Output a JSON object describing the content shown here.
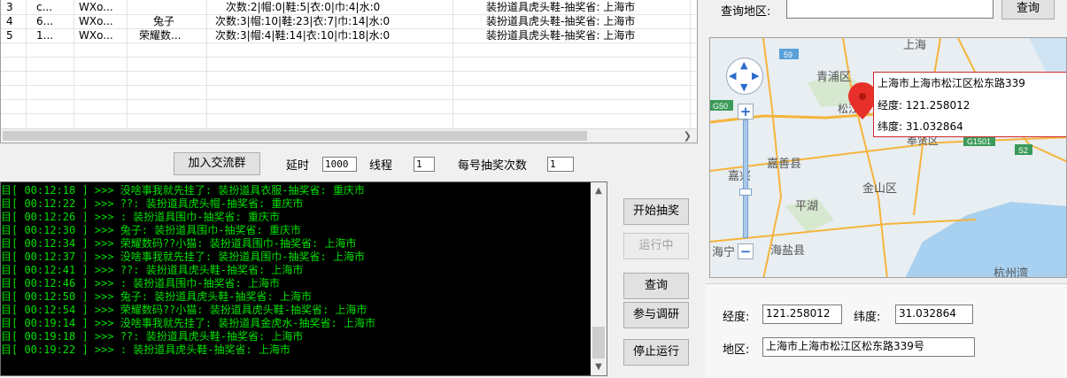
{
  "table": {
    "rows": [
      {
        "id": "3",
        "c1": "c...",
        "c2": "WXo...",
        "c3": "",
        "stats": "次数:2|帽:0|鞋:5|衣:0|巾:4|水:0",
        "log": "装扮道具虎头鞋-抽奖省: 上海市"
      },
      {
        "id": "4",
        "c1": "6...",
        "c2": "WXo...",
        "c3": "兔子",
        "stats": "次数:3|帽:10|鞋:23|衣:7|巾:14|水:0",
        "log": "装扮道具虎头鞋-抽奖省: 上海市"
      },
      {
        "id": "5",
        "c1": "1...",
        "c2": "WXo...",
        "c3": "荣耀数...",
        "stats": "次数:3|帽:4|鞋:14|衣:10|巾:18|水:0",
        "log": "装扮道具虎头鞋-抽奖省: 上海市"
      }
    ]
  },
  "controls": {
    "join_group": "加入交流群",
    "delay_label": "延时",
    "delay_value": "1000",
    "threads_label": "线程",
    "threads_value": "1",
    "per_account_label": "每号抽奖次数",
    "per_account_value": "1"
  },
  "log": {
    "lines": [
      "目[ 00:12:18 ] >>> 没啥事我就先挂了: 装扮道具衣服-抽奖省: 重庆市",
      "目[ 00:12:22 ] >>> ??: 装扮道具虎头帽-抽奖省: 重庆市",
      "目[ 00:12:26 ] >>> : 装扮道具围巾-抽奖省: 重庆市",
      "目[ 00:12:30 ] >>> 兔子: 装扮道具围巾-抽奖省: 重庆市",
      "目[ 00:12:34 ] >>> 荣耀数码??小猫: 装扮道具围巾-抽奖省: 上海市",
      "目[ 00:12:37 ] >>> 没啥事我就先挂了: 装扮道具围巾-抽奖省: 上海市",
      "目[ 00:12:41 ] >>> ??: 装扮道具虎头鞋-抽奖省: 上海市",
      "目[ 00:12:46 ] >>> : 装扮道具围巾-抽奖省: 上海市",
      "目[ 00:12:50 ] >>> 兔子: 装扮道具虎头鞋-抽奖省: 上海市",
      "目[ 00:12:54 ] >>> 荣耀数码??小猫: 装扮道具虎头鞋-抽奖省: 上海市",
      "目[ 00:19:14 ] >>> 没啥事我就先挂了: 装扮道具金虎水-抽奖省: 上海市",
      "目[ 00:19:18 ] >>> ??: 装扮道具虎头鞋-抽奖省: 上海市",
      "目[ 00:19:22 ] >>> : 装扮道具虎头鞋-抽奖省: 上海市"
    ]
  },
  "actions": {
    "start": "开始抽奖",
    "running": "运行中",
    "query": "查询",
    "survey": "参与调研",
    "stop": "停止运行"
  },
  "right": {
    "query_region_label": "查询地区:",
    "query_region_value": "",
    "query_button": "查询",
    "map": {
      "popup_address": "上海市上海市松江区松东路339",
      "popup_lng": "经度: 121.258012",
      "popup_lat": "纬度: 31.032864",
      "places": [
        "上海",
        "青浦区",
        "松江区",
        "奉贤区",
        "嘉善县",
        "嘉兴",
        "金山区",
        "平湖",
        "海宁",
        "海盐县",
        "杭州湾"
      ],
      "road_labels": [
        "59",
        "G50",
        "G1501",
        "S2"
      ]
    },
    "lng_label": "经度:",
    "lng_value": "121.258012",
    "lat_label": "纬度:",
    "lat_value": "31.032864",
    "area_label": "地区:",
    "area_value": "上海市上海市松江区松东路339号"
  },
  "colors": {
    "log_text": "#00e000",
    "map_land": "#e8eef2",
    "map_water": "#a8d0f0",
    "map_road": "#f5b43c",
    "marker": "#e8302a"
  }
}
